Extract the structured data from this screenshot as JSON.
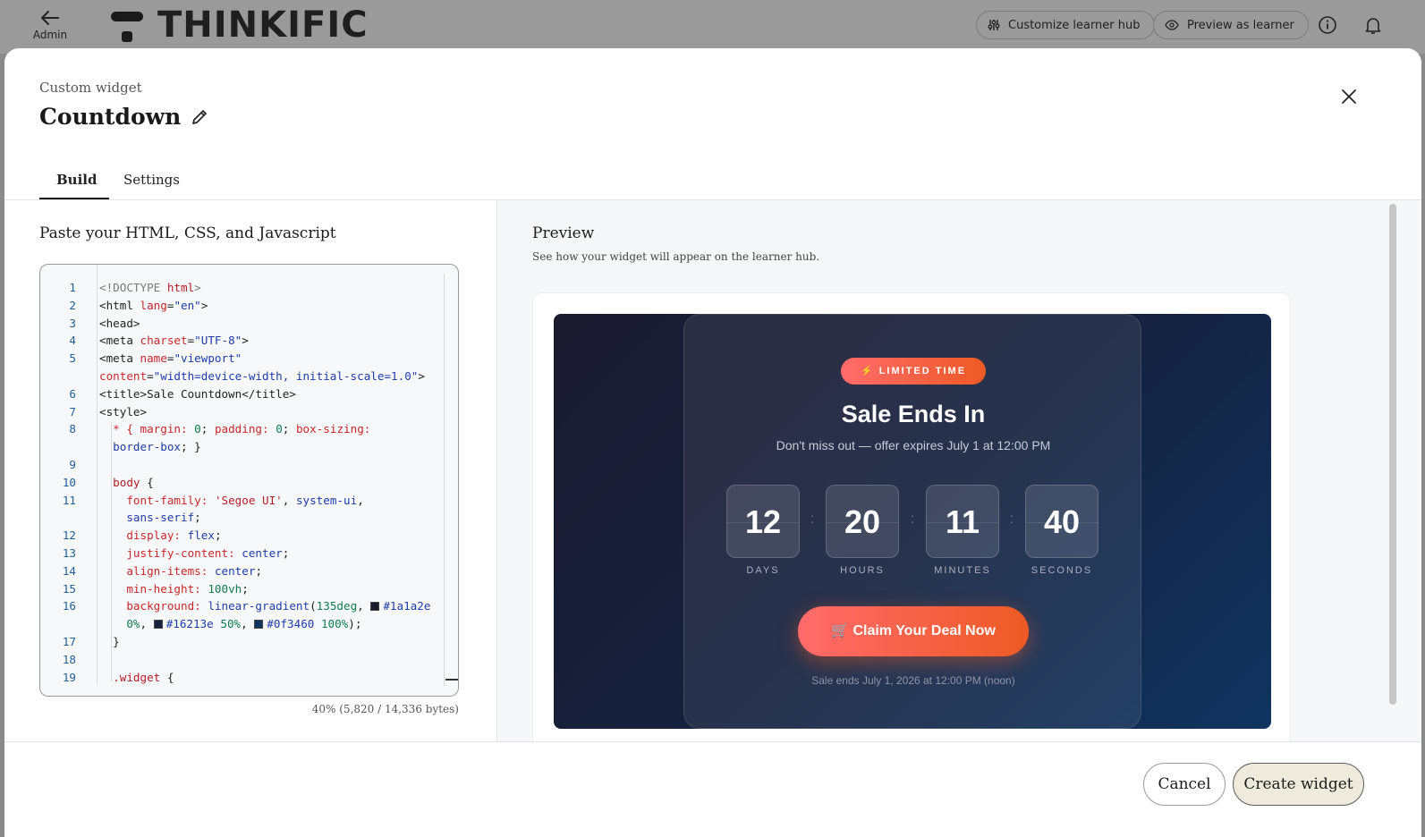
{
  "appbar": {
    "back_label": "Admin",
    "brand": "THINKIFIC",
    "customize_label": "Customize learner hub",
    "preview_label": "Preview as learner"
  },
  "modal": {
    "eyebrow": "Custom widget",
    "title": "Countdown",
    "tabs": [
      {
        "label": "Build",
        "active": true
      },
      {
        "label": "Settings",
        "active": false
      }
    ]
  },
  "build": {
    "heading": "Paste your HTML, CSS, and Javascript",
    "line_numbers": [
      "1",
      "2",
      "3",
      "4",
      "5",
      "",
      "6",
      "7",
      "8",
      "",
      "9",
      "10",
      "11",
      "",
      "12",
      "13",
      "14",
      "15",
      "16",
      "",
      "17",
      "18",
      "19"
    ],
    "byte_usage": "40% (5,820 / 14,336 bytes)"
  },
  "preview": {
    "title": "Preview",
    "subtitle": "See how your widget will appear on the learner hub.",
    "badge": "⚡ LIMITED TIME",
    "heading": "Sale Ends In",
    "subheading": "Don't miss out — offer expires July 1 at 12:00 PM",
    "units": [
      {
        "value": "12",
        "label": "DAYS"
      },
      {
        "value": "20",
        "label": "HOURS"
      },
      {
        "value": "11",
        "label": "MINUTES"
      },
      {
        "value": "40",
        "label": "SECONDS"
      }
    ],
    "separator": ":",
    "cta": "🛒 Claim Your Deal Now",
    "footnote": "Sale ends July 1, 2026 at 12:00 PM (noon)"
  },
  "footer": {
    "cancel_label": "Cancel",
    "create_label": "Create widget"
  },
  "colors": {
    "accent_start": "#ff6b6b",
    "accent_end": "#ee5a24",
    "primary_button_bg": "#efebdc"
  }
}
